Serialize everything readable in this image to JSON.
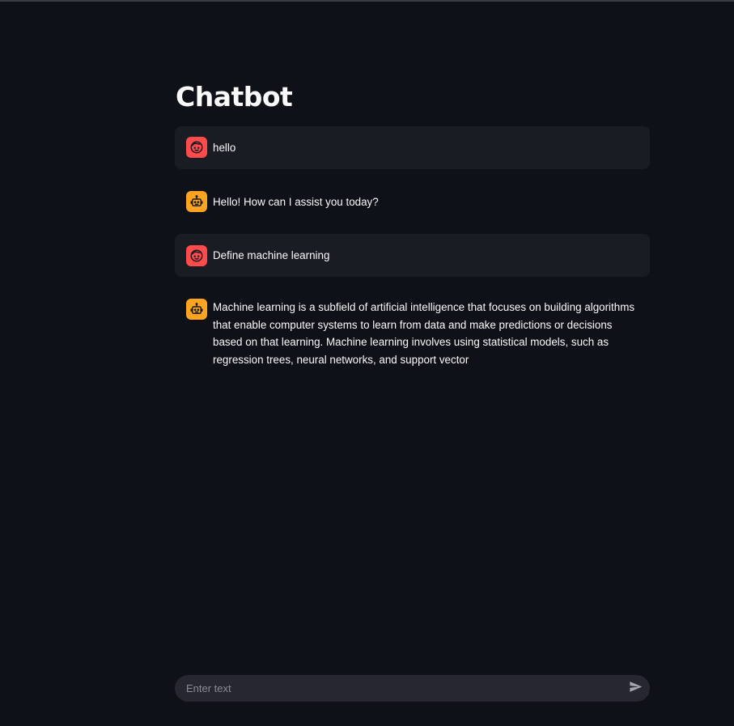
{
  "page": {
    "title": "Chatbot"
  },
  "messages": [
    {
      "role": "user",
      "avatar_icon": "user-face-icon",
      "text": "hello"
    },
    {
      "role": "assistant",
      "avatar_icon": "robot-icon",
      "text": "Hello! How can I assist you today?"
    },
    {
      "role": "user",
      "avatar_icon": "user-face-icon",
      "text": "Define machine learning"
    },
    {
      "role": "assistant",
      "avatar_icon": "robot-icon",
      "text": "Machine learning is a subfield of artificial intelligence that focuses on building algorithms that enable computer systems to learn from data and make predictions or decisions based on that learning. Machine learning involves using statistical models, such as regression trees, neural networks, and support vector"
    }
  ],
  "chat_input": {
    "placeholder": "Enter text",
    "value": "",
    "send_icon": "send-icon"
  },
  "colors": {
    "background": "#0e1117",
    "user_message_bg": "#1a1c24",
    "user_avatar": "#ff4b4b",
    "assistant_avatar": "#ffa421",
    "input_bg": "#262730",
    "text": "#fafafa"
  }
}
